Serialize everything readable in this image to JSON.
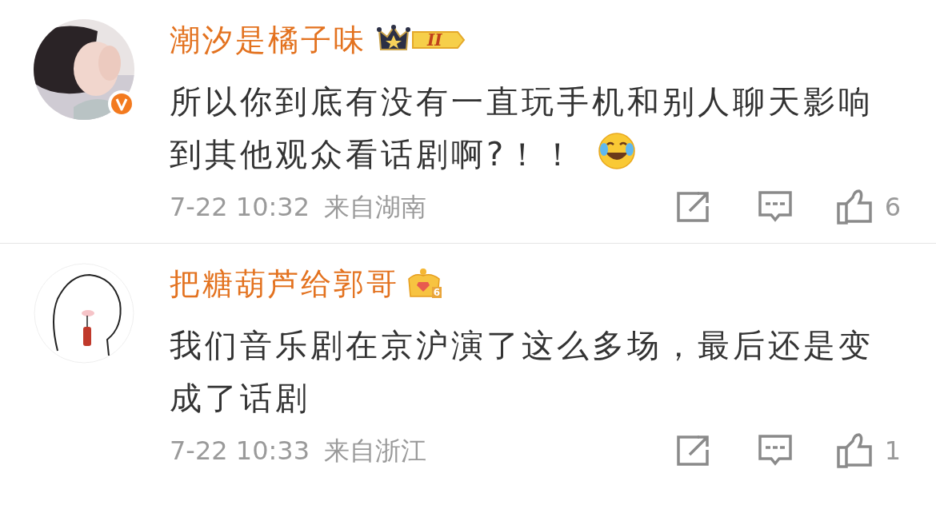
{
  "comments": [
    {
      "verified": true,
      "name": "潮汐是橘子味",
      "badge": {
        "kind": "crown_level",
        "label": "II"
      },
      "text": "所以你到底有没有一直玩手机和别人聊天影响到其他观众看话剧啊?！！",
      "emoji": true,
      "time": "7-22 10:32",
      "location": "来自湖南",
      "likes": "6"
    },
    {
      "avatar": {
        "kind": "drawing"
      },
      "verified": false,
      "name": "把糖葫芦给郭哥",
      "badge": {
        "kind": "crown_gem",
        "label": "6"
      },
      "text": "我们音乐剧在京沪演了这么多场，最后还是变成了话剧",
      "emoji": false,
      "time": "7-22 10:33",
      "location": "来自浙江",
      "likes": "1"
    }
  ]
}
